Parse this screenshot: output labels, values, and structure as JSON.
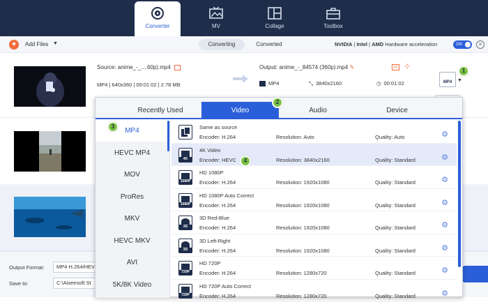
{
  "top_tabs": [
    {
      "label": "Converter",
      "icon": "converter-icon"
    },
    {
      "label": "MV",
      "icon": "mv-icon"
    },
    {
      "label": "Collage",
      "icon": "collage-icon"
    },
    {
      "label": "Toolbox",
      "icon": "toolbox-icon"
    }
  ],
  "toolbar": {
    "add_files": "Add Files",
    "seg_converting": "Converting",
    "seg_converted": "Converted",
    "hw_nvidia": "NVIDIA",
    "hw_intel": "Intel",
    "hw_amd": "AMD",
    "hw_label": "Hardware acceleration",
    "toggle_label": "ON"
  },
  "file": {
    "source": "Source: anime_-_....60p).mp4",
    "meta": "MP4  |  640x360  |  00:01:02  |  2.78 MB",
    "output": "Output: anime_-_84574 (360p).mp4",
    "out_format": "MP4",
    "out_resolution": "3840x2160",
    "out_duration": "00:01:02",
    "badge": "MP4"
  },
  "bottom": {
    "output_format_label": "Output Format:",
    "output_format_value": "MP4 H.264/HEV",
    "save_to_label": "Save to:",
    "save_to_value": "C:\\Aiseesoft St"
  },
  "dialog": {
    "tabs": [
      "Recently Used",
      "Video",
      "Audio",
      "Device"
    ],
    "formats": [
      "MP4",
      "HEVC MP4",
      "MOV",
      "ProRes",
      "MKV",
      "HEVC MKV",
      "AVI",
      "5K/8K Video"
    ],
    "presets": [
      {
        "name": "Same as source",
        "encoder": "Encoder: H.264",
        "resolution": "Resolution: Auto",
        "quality": "Quality: Auto",
        "tag": ""
      },
      {
        "name": "4K Video",
        "encoder": "Encoder: HEVC",
        "resolution": "Resolution: 3840x2160",
        "quality": "Quality: Standard",
        "tag": "4K"
      },
      {
        "name": "HD 1080P",
        "encoder": "Encoder: H.264",
        "resolution": "Resolution: 1920x1080",
        "quality": "Quality: Standard",
        "tag": "1080P"
      },
      {
        "name": "HD 1080P Auto Correct",
        "encoder": "Encoder: H.264",
        "resolution": "Resolution: 1920x1080",
        "quality": "Quality: Standard",
        "tag": "1080P"
      },
      {
        "name": "3D Red-Blue",
        "encoder": "Encoder: H.264",
        "resolution": "Resolution: 1920x1080",
        "quality": "Quality: Standard",
        "tag": "3D"
      },
      {
        "name": "3D Left-Right",
        "encoder": "Encoder: H.264",
        "resolution": "Resolution: 1920x1080",
        "quality": "Quality: Standard",
        "tag": "3D"
      },
      {
        "name": "HD 720P",
        "encoder": "Encoder: H.264",
        "resolution": "Resolution: 1280x720",
        "quality": "Quality: Standard",
        "tag": "720P"
      },
      {
        "name": "HD 720P Auto Correct",
        "encoder": "Encoder: H.264",
        "resolution": "Resolution: 1280x720",
        "quality": "Quality: Standard",
        "tag": "720P"
      }
    ]
  },
  "steps": [
    "1",
    "2",
    "3",
    "4"
  ],
  "colors": {
    "accent": "#2b5fd9",
    "header": "#1e2d4a",
    "step": "#7cc242",
    "add": "#f26a3a"
  }
}
